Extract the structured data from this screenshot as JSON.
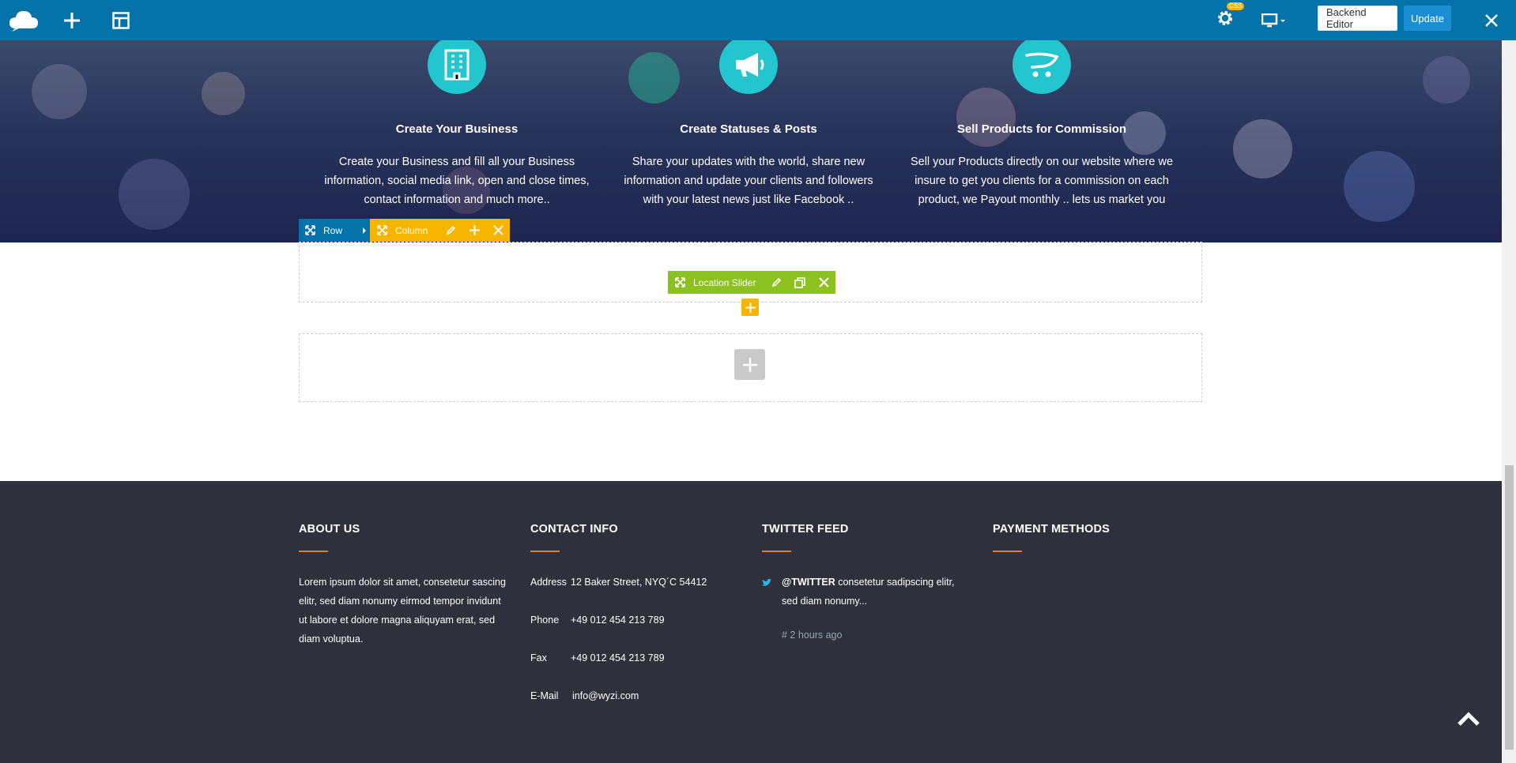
{
  "toolbar": {
    "css_badge": "CSS",
    "backend_editor_label": "Backend Editor",
    "update_label": "Update",
    "icons": [
      "logo-cloud-icon",
      "add-element-icon",
      "templates-icon",
      "settings-icon",
      "responsive-desktop-icon",
      "close-icon"
    ]
  },
  "features": [
    {
      "icon": "building-icon",
      "title": "Create Your Business",
      "text": "Create your Business and fill all your Business information, social media link, open and close times, contact information and much more.."
    },
    {
      "icon": "megaphone-icon",
      "title": "Create Statuses & Posts",
      "text": "Share your updates with the world, share new information and update your clients and followers with your latest news just like Facebook .."
    },
    {
      "icon": "cart-icon",
      "title": "Sell Products for Commission",
      "text": "Sell your Products directly on our website where we insure to get you clients for a commission on each product, we Payout monthly .. lets us market you"
    }
  ],
  "editor": {
    "row_label": "Row",
    "column_label": "Column",
    "element_label": "Location Slider"
  },
  "footer": {
    "about": {
      "title": "ABOUT US",
      "text": "Lorem ipsum dolor sit amet, consetetur sascing elitr, sed diam nonumy eirmod tempor invidunt ut labore et dolore magna aliquyam erat, sed diam voluptua."
    },
    "contact": {
      "title": "CONTACT INFO",
      "rows": [
        {
          "label": "Address",
          "value": "12 Baker Street, NYQ´C 54412"
        },
        {
          "label": "Phone",
          "value": "+49 012 454 213 789"
        },
        {
          "label": "Fax",
          "value": "+49 012 454 213 789"
        },
        {
          "label": "E-Mail",
          "value": "info@wyzi.com"
        }
      ]
    },
    "twitter": {
      "title": "TWITTER FEED",
      "handle": "@TWITTER",
      "text": " consetetur sadipscing elitr, sed diam nonumy...",
      "ago": "# 2 hours ago"
    },
    "payment": {
      "title": "PAYMENT METHODS"
    }
  },
  "colors": {
    "toolbar": "#0473aa",
    "feature_circle": "#23c6cf",
    "row_control": "#0473aa",
    "column_control": "#f7b500",
    "element_control": "#8cc21f",
    "footer_bg": "#2e313b",
    "footer_accent": "#e67e22"
  }
}
